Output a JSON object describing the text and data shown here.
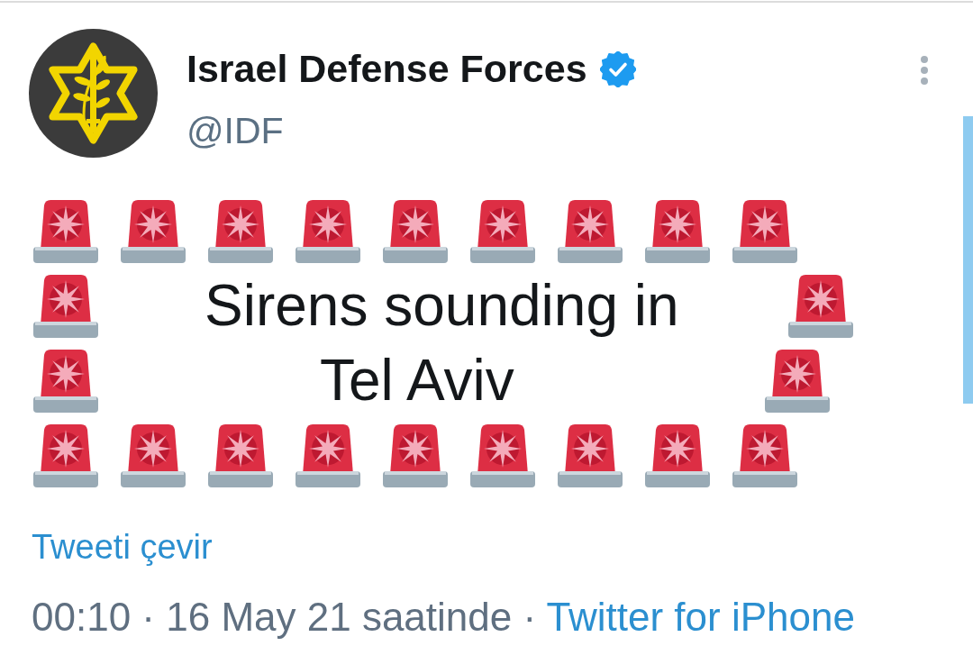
{
  "author": {
    "name": "Israel Defense Forces",
    "verified": true,
    "handle": "@IDF"
  },
  "tweet_lines": [
    {
      "items": [
        {
          "kind": "siren"
        },
        {
          "kind": "siren"
        },
        {
          "kind": "siren"
        },
        {
          "kind": "siren"
        },
        {
          "kind": "siren"
        },
        {
          "kind": "siren"
        },
        {
          "kind": "siren"
        },
        {
          "kind": "siren"
        },
        {
          "kind": "siren"
        }
      ]
    },
    {
      "items": [
        {
          "kind": "siren"
        },
        {
          "kind": "text",
          "text": "Sirens sounding in"
        },
        {
          "kind": "siren"
        }
      ]
    },
    {
      "items": [
        {
          "kind": "siren"
        },
        {
          "kind": "text",
          "text": "Tel Aviv"
        },
        {
          "kind": "siren"
        }
      ]
    },
    {
      "items": [
        {
          "kind": "siren"
        },
        {
          "kind": "siren"
        },
        {
          "kind": "siren"
        },
        {
          "kind": "siren"
        },
        {
          "kind": "siren"
        },
        {
          "kind": "siren"
        },
        {
          "kind": "siren"
        },
        {
          "kind": "siren"
        },
        {
          "kind": "siren"
        }
      ]
    }
  ],
  "translate_link": "Tweeti çevir",
  "meta": {
    "timestamp": "00:10 · 16 May 21 saatinde ·",
    "source": "Twitter for iPhone"
  }
}
